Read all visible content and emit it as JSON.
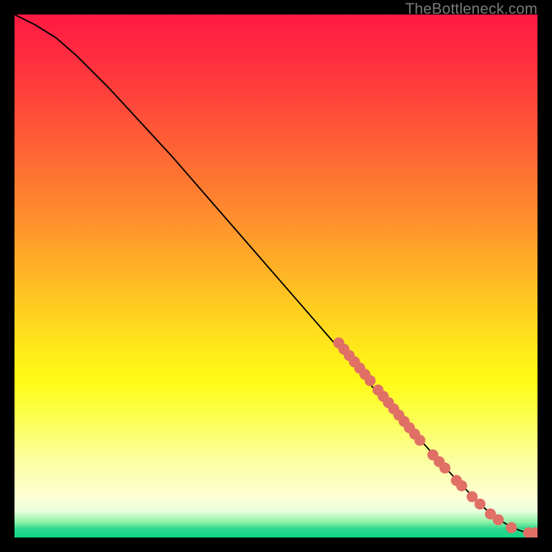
{
  "watermark": "TheBottleneck.com",
  "chart_data": {
    "type": "line",
    "title": "",
    "xlabel": "",
    "ylabel": "",
    "xlim": [
      0,
      100
    ],
    "ylim": [
      0,
      100
    ],
    "series": [
      {
        "name": "curve",
        "x": [
          0,
          4,
          8,
          12,
          18,
          30,
          50,
          70,
          85,
          90,
          93,
          95,
          97,
          99,
          100
        ],
        "y": [
          100,
          98,
          95.5,
          92,
          86,
          73,
          50,
          27,
          10.5,
          5.5,
          3.2,
          2.0,
          1.2,
          0.9,
          0.9
        ]
      }
    ],
    "points": [
      {
        "name": "cluster-a",
        "x": 62.0,
        "y": 37.2
      },
      {
        "name": "cluster-a",
        "x": 63.0,
        "y": 36.0
      },
      {
        "name": "cluster-a",
        "x": 64.0,
        "y": 34.8
      },
      {
        "name": "cluster-a",
        "x": 65.0,
        "y": 33.6
      },
      {
        "name": "cluster-a",
        "x": 66.0,
        "y": 32.4
      },
      {
        "name": "cluster-a",
        "x": 67.0,
        "y": 31.2
      },
      {
        "name": "cluster-a",
        "x": 68.0,
        "y": 30.0
      },
      {
        "name": "cluster-b",
        "x": 69.5,
        "y": 28.2
      },
      {
        "name": "cluster-b",
        "x": 70.5,
        "y": 27.0
      },
      {
        "name": "cluster-b",
        "x": 71.5,
        "y": 25.8
      },
      {
        "name": "cluster-b",
        "x": 72.5,
        "y": 24.6
      },
      {
        "name": "cluster-b",
        "x": 73.5,
        "y": 23.4
      },
      {
        "name": "cluster-b",
        "x": 74.5,
        "y": 22.2
      },
      {
        "name": "cluster-b",
        "x": 75.5,
        "y": 21.0
      },
      {
        "name": "cluster-b",
        "x": 76.5,
        "y": 19.8
      },
      {
        "name": "cluster-b",
        "x": 77.5,
        "y": 18.6
      },
      {
        "name": "cluster-c",
        "x": 80.0,
        "y": 15.8
      },
      {
        "name": "cluster-c",
        "x": 81.2,
        "y": 14.5
      },
      {
        "name": "cluster-c",
        "x": 82.3,
        "y": 13.3
      },
      {
        "name": "cluster-d",
        "x": 84.5,
        "y": 10.9
      },
      {
        "name": "cluster-d",
        "x": 85.5,
        "y": 9.9
      },
      {
        "name": "cluster-e",
        "x": 87.5,
        "y": 7.8
      },
      {
        "name": "cluster-e",
        "x": 89.0,
        "y": 6.4
      },
      {
        "name": "cluster-f",
        "x": 91.0,
        "y": 4.5
      },
      {
        "name": "cluster-f",
        "x": 92.5,
        "y": 3.4
      },
      {
        "name": "cluster-g",
        "x": 95.0,
        "y": 1.9
      },
      {
        "name": "cluster-h",
        "x": 98.3,
        "y": 0.9
      },
      {
        "name": "cluster-h",
        "x": 99.7,
        "y": 0.9
      }
    ],
    "gradient_bands": [
      {
        "color": "#ff1a43",
        "stop": 0
      },
      {
        "color": "#ffd41f",
        "stop": 58
      },
      {
        "color": "#fffb15",
        "stop": 70
      },
      {
        "color": "#0fd686",
        "stop": 100
      }
    ]
  }
}
